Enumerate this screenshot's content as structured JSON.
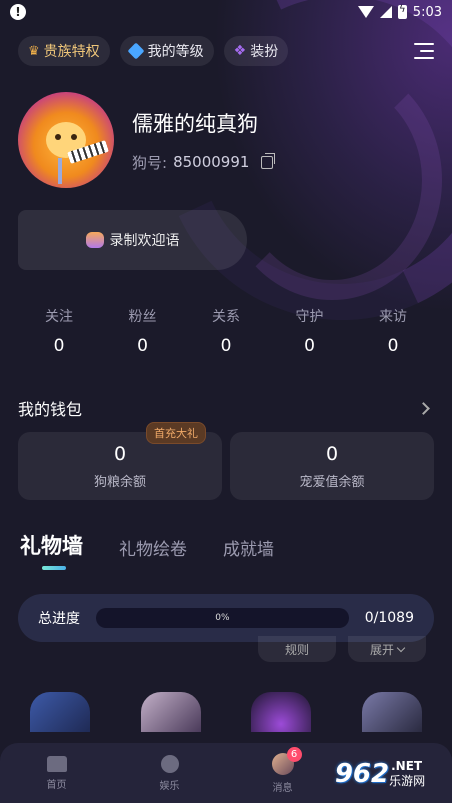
{
  "status_bar": {
    "time": "5:03",
    "alert_icon": "!"
  },
  "top_tabs": [
    {
      "label": "贵族特权",
      "icon": "crown-icon"
    },
    {
      "label": "我的等级",
      "icon": "gem-icon"
    },
    {
      "label": "装扮",
      "icon": "bow-icon"
    }
  ],
  "profile": {
    "nickname": "儒雅的纯真狗",
    "uid_label": "狗号:",
    "uid": "85000991"
  },
  "record_greeting": {
    "label": "录制欢迎语"
  },
  "stats": [
    {
      "label": "关注",
      "value": "0"
    },
    {
      "label": "粉丝",
      "value": "0"
    },
    {
      "label": "关系",
      "value": "0"
    },
    {
      "label": "守护",
      "value": "0"
    },
    {
      "label": "来访",
      "value": "0"
    }
  ],
  "wallet": {
    "title": "我的钱包",
    "cards": [
      {
        "value": "0",
        "label": "狗粮余额",
        "badge": "首充大礼"
      },
      {
        "value": "0",
        "label": "宠爱值余额"
      }
    ]
  },
  "gift_tabs": [
    {
      "label": "礼物墙",
      "active": true
    },
    {
      "label": "礼物绘卷",
      "active": false
    },
    {
      "label": "成就墙",
      "active": false
    }
  ],
  "progress": {
    "label": "总进度",
    "percent_text": "0%",
    "percent": 0,
    "count": "0/1089"
  },
  "sub_actions": {
    "rules": "规则",
    "expand": "展开"
  },
  "bottom_nav": [
    {
      "label": "首页",
      "icon": "home-icon"
    },
    {
      "label": "娱乐",
      "icon": "play-icon"
    },
    {
      "label": "消息",
      "icon": "msg-avatar-icon",
      "badge": "6"
    }
  ],
  "watermark": {
    "num": "962",
    "net": ".NET",
    "cn": "乐游网"
  },
  "colors": {
    "background": "#1b1a2a",
    "accent_purple": "#7a5cff",
    "badge_red": "#ff4d6d",
    "gold": "#f0c77a"
  }
}
